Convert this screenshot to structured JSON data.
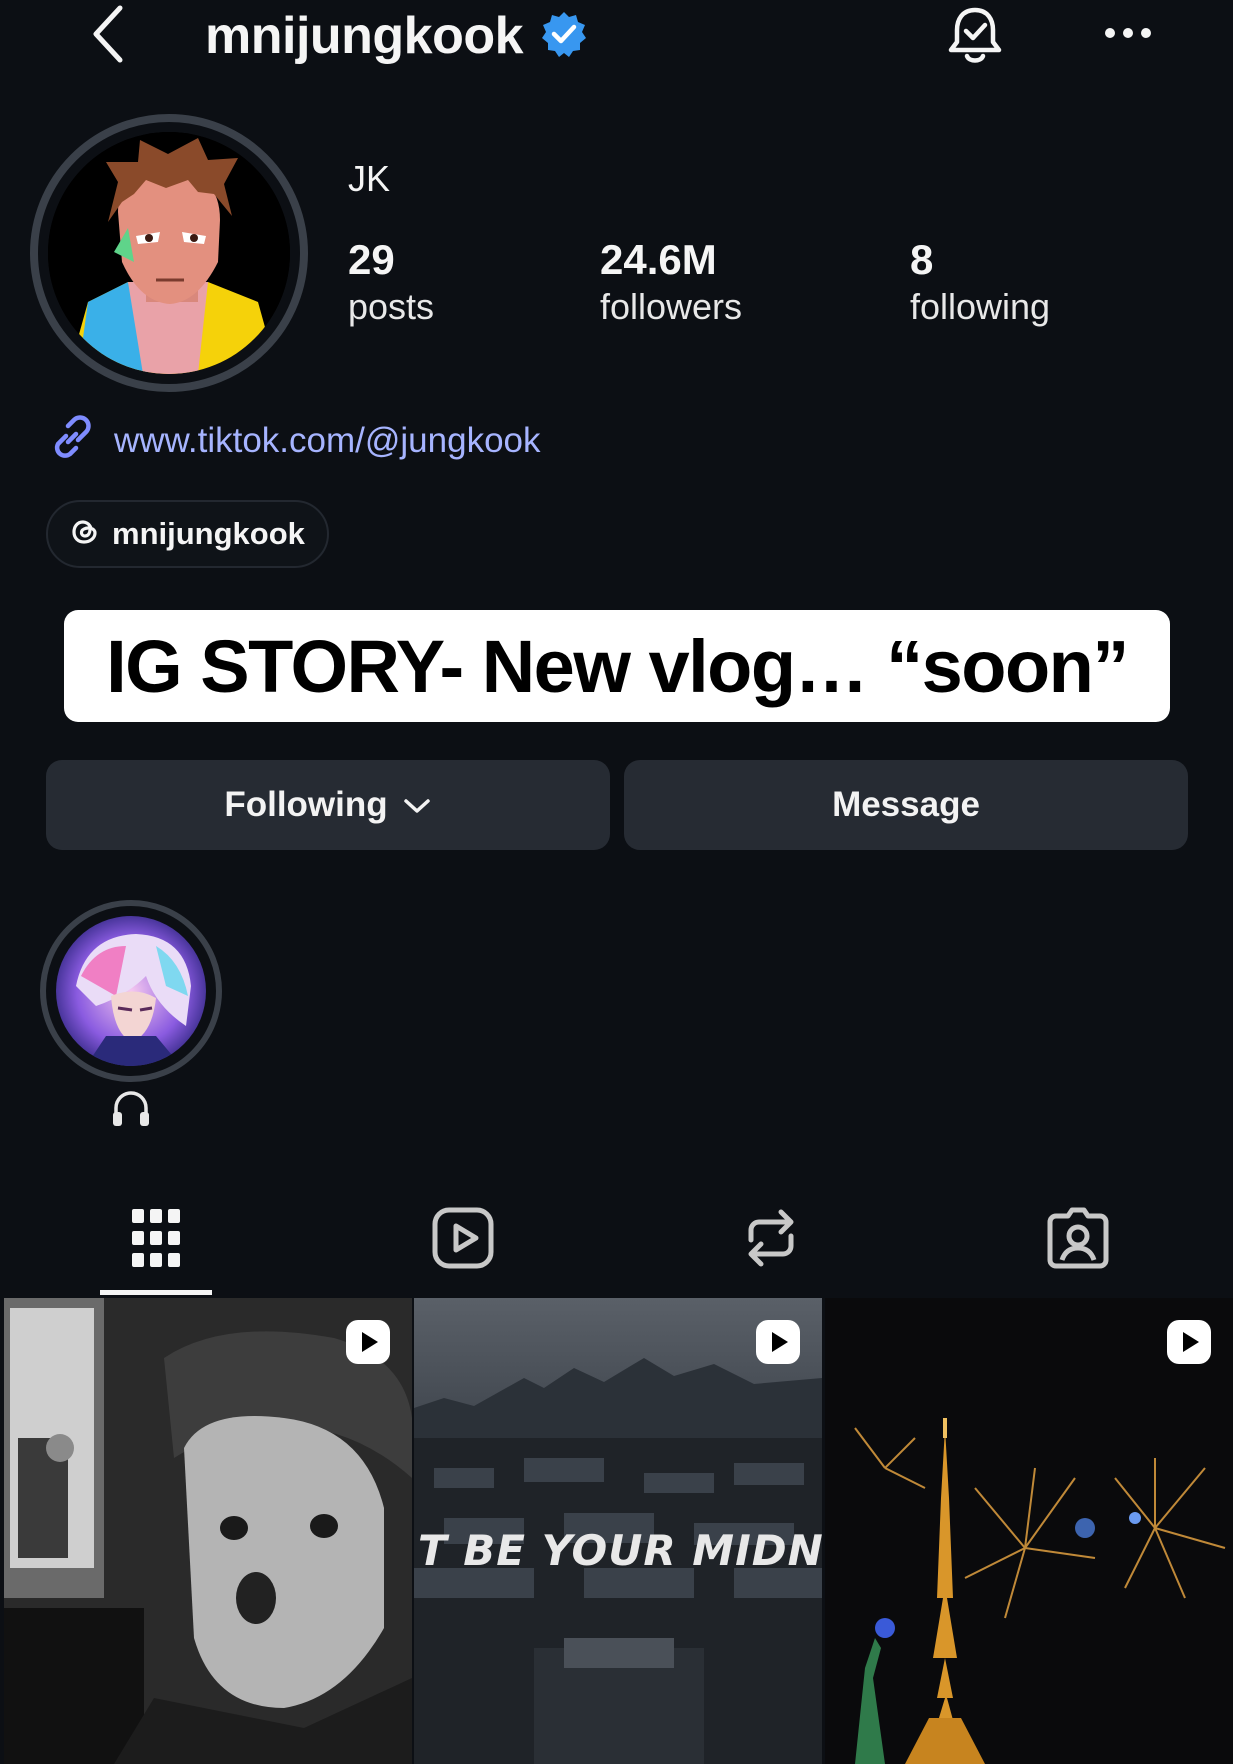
{
  "header": {
    "username": "mnijungkook",
    "back_icon": "chevron-left-icon",
    "verified_icon": "verified-badge-icon",
    "bell_icon": "bell-check-icon",
    "more_icon": "more-horizontal-icon"
  },
  "profile": {
    "display_name": "JK",
    "stats": [
      {
        "value": "29",
        "label": "posts"
      },
      {
        "value": "24.6M",
        "label": "followers"
      },
      {
        "value": "8",
        "label": "following"
      }
    ],
    "link": "www.tiktok.com/@jungkook",
    "threads_handle": "mnijungkook"
  },
  "caption_overlay": "IG STORY- New vlog… “soon”",
  "actions": {
    "following_label": "Following",
    "message_label": "Message"
  },
  "highlight": {
    "icon": "headphones-icon"
  },
  "tabs": [
    "grid-icon",
    "reels-icon",
    "reposts-icon",
    "tagged-icon"
  ],
  "grid": [
    {
      "kind": "reel",
      "overlay_text": ""
    },
    {
      "kind": "reel",
      "overlay_text": "T BE YOUR MIDNIGHT"
    },
    {
      "kind": "reel",
      "overlay_text": ""
    }
  ],
  "colors": {
    "background": "#0c0f14",
    "button": "#262b33",
    "link": "#a6b4ff",
    "verified": "#3897f0"
  }
}
